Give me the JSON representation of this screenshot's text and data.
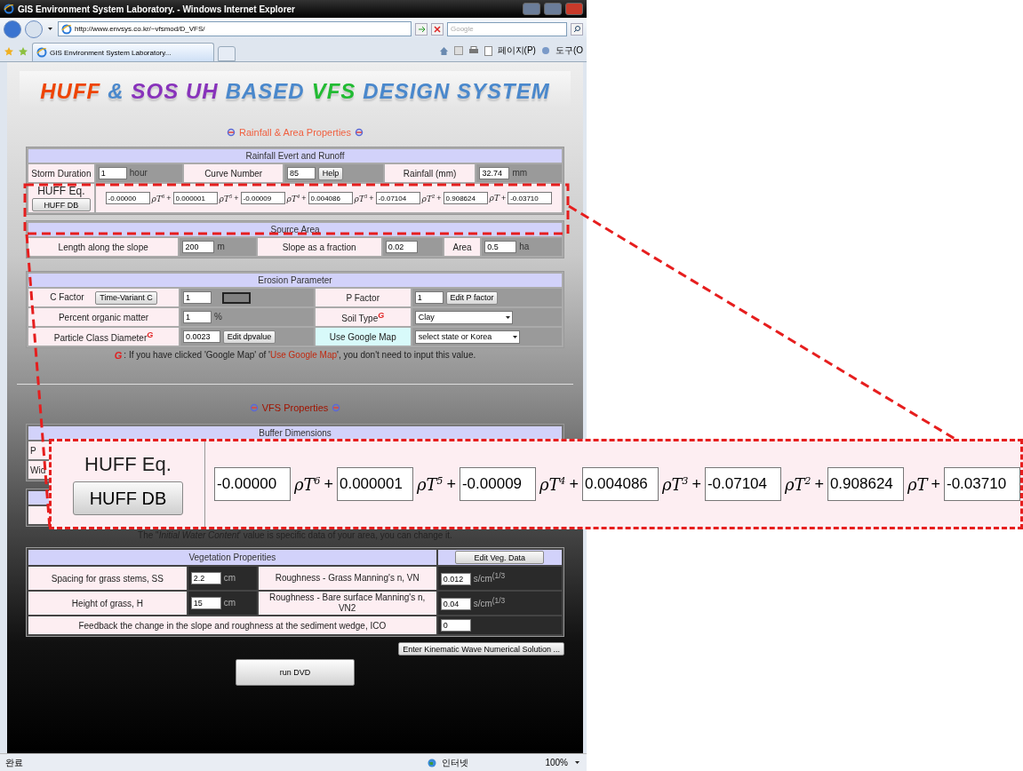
{
  "window": {
    "title": "GIS Environment System Laboratory. - Windows Internet Explorer"
  },
  "address_bar": {
    "url": "http://www.envsys.co.kr/~vfsmod/D_VFS/"
  },
  "search": {
    "placeholder": "Google"
  },
  "tabs": [
    {
      "label": "GIS Environment System Laboratory...",
      "selected": true
    }
  ],
  "command_bar": {
    "page": "페이지(P)",
    "tools": "도구(O"
  },
  "banner": {
    "parts": [
      {
        "text": "HUFF",
        "color": "#ee4400"
      },
      {
        "text": "&",
        "color": "#4a88cc"
      },
      {
        "text": "SOS UH",
        "color": "#8833bb"
      },
      {
        "text": "BASED",
        "color": "#4a88cc"
      },
      {
        "text": "VFS",
        "color": "#22bb33"
      },
      {
        "text": "DESIGN SYSTEM",
        "color": "#4a88cc"
      }
    ]
  },
  "rainfall_heading": "Rainfall & Area Properties",
  "rainfall": {
    "title": "Rainfall Evert and Runoff",
    "storm_label": "Storm Duration",
    "storm_value": "1",
    "storm_unit": "hour",
    "cn_label": "Curve Number",
    "cn_value": "85",
    "cn_button": "Help",
    "rain_label": "Rainfall (mm)",
    "rain_value": "32.74",
    "rain_unit": "mm",
    "huff_label": "HUFF Eq.",
    "huff_button": "HUFF DB",
    "terms": [
      {
        "coef": "-0.00000",
        "term": "ρT$^{6}$",
        "plus": "+"
      },
      {
        "coef": "0.000001",
        "term": "ρT$^{5}$",
        "plus": "+"
      },
      {
        "coef": "-0.00009",
        "term": "ρT$^{4}$",
        "plus": "+"
      },
      {
        "coef": "0.004086",
        "term": "ρT$^{3}$",
        "plus": "+"
      },
      {
        "coef": "-0.07104",
        "term": "ρT$^{2}$",
        "plus": "+"
      },
      {
        "coef": "0.908624",
        "term": "ρT",
        "plus": "+"
      },
      {
        "coef": "-0.03710"
      }
    ]
  },
  "source_area": {
    "title": "Source Area",
    "fields": [
      {
        "label": "Length along the slope",
        "value": "200",
        "unit": "m"
      },
      {
        "label": "Slope as a fraction",
        "value": "0.02"
      },
      {
        "label": "Area",
        "value": "0.5",
        "unit": "ha"
      }
    ]
  },
  "erosion": {
    "title": "Erosion Parameter",
    "c_label": "C Factor",
    "c_button": "Time-Variant C",
    "c_value": "1",
    "p_label": "P Factor",
    "p_value": "1",
    "p_button": "Edit P factor",
    "om_label": "Percent organic matter",
    "om_value": "1",
    "om_unit": "%",
    "soil_label": "Soil Type",
    "soil_mark": "G",
    "soil_value": "Clay",
    "dp_label": "Particle Class Diameter",
    "dp_mark": "G",
    "dp_value": "0.0023",
    "dp_button": "Edit dpvalue",
    "map_label": "Use Google Map",
    "map_value": "select state or Korea"
  },
  "erosion_note": {
    "mark": "G",
    "before": ": If you have clicked 'Google Map' of '",
    "link": "Use Google Map",
    "after": "', you don't need to input this value."
  },
  "vfs_heading": "VFS Properties",
  "buffer": {
    "title": "Buffer Dimensions",
    "row_labels": [
      "P",
      "Wid"
    ]
  },
  "water_note": "The \"*Initial Water Content*' value is specific data of your area, you can change it.",
  "vegetation": {
    "title": "Vegetation Properities",
    "button": "Edit Veg. Data",
    "rows": [
      {
        "label": "Spacing for grass stems, SS",
        "value": "2.2",
        "unit": "cm",
        "label2": "Roughness - Grass Manning's n, VN",
        "value2": "0.012",
        "unit2": "s/cm$^{(1/3}$"
      },
      {
        "label": "Height of grass, H",
        "value": "15",
        "unit": "cm",
        "label2": "Roughness - Bare surface Manning's n, VN2",
        "value2": "0.04",
        "unit2": "s/cm$^{(1/3}$"
      }
    ],
    "feedback_label": "Feedback the change in the slope and roughness at the sediment wedge, ICO",
    "feedback_value": "0"
  },
  "kinematic_button": "Enter Kinematic Wave Numerical Solution ...",
  "run_button": "run DVD",
  "status_bar": {
    "status": "완료",
    "zone": "인터넷",
    "zoom": "100%"
  },
  "callout": {
    "label": "HUFF Eq.",
    "button": "HUFF DB",
    "terms": [
      {
        "coef": "-0.00000",
        "term": "ρT$^{6}$",
        "plus": "+"
      },
      {
        "coef": "0.000001",
        "term": "ρT$^{5}$",
        "plus": "+"
      },
      {
        "coef": "-0.00009",
        "term": "ρT$^{4}$",
        "plus": "+"
      },
      {
        "coef": "0.004086",
        "term": "ρT$^{3}$",
        "plus": "+"
      },
      {
        "coef": "-0.07104",
        "term": "ρT$^{2}$",
        "plus": "+"
      },
      {
        "coef": "0.908624",
        "term": "ρT",
        "plus": "+"
      },
      {
        "coef": "-0.03710"
      }
    ]
  }
}
